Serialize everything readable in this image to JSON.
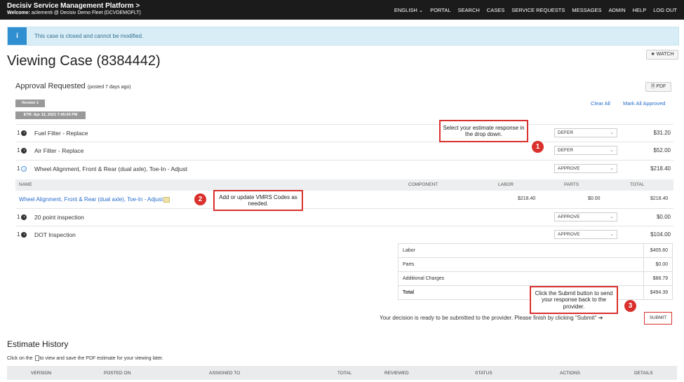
{
  "header": {
    "brand": "Decisiv Service Management Platform",
    "brand_chevron": ">",
    "welcome_prefix": "Welcome:",
    "welcome_text": "aclementi @ Decisiv Demo Fleet (DCVDEMOFLT)",
    "nav": [
      "ENGLISH ⌄",
      "PORTAL",
      "SEARCH",
      "CASES",
      "SERVICE REQUESTS",
      "MESSAGES",
      "ADMIN",
      "HELP",
      "LOG OUT"
    ]
  },
  "alert": {
    "icon": "i",
    "text": "This case is closed and cannot be modified."
  },
  "page": {
    "title": "Viewing Case (8384442)",
    "watch_label": "★ WATCH"
  },
  "approval": {
    "title": "Approval Requested",
    "posted": "(posted 7 days ago)",
    "pdf_label": "PDF",
    "version": "Version 1",
    "etr": "ETR: Apr 12, 2021 7:45:00 PM",
    "clear_all": "Clear All",
    "mark_all": "Mark All Approved"
  },
  "items": [
    {
      "qty": "1",
      "name": "Fuel Filter - Replace",
      "select": "DEFER",
      "price": "$31.20"
    },
    {
      "qty": "1",
      "name": "Air Filter - Replace",
      "select": "DEFER",
      "price": "$52.00"
    },
    {
      "qty": "1",
      "name": "Wheel Alignment, Front & Rear (dual axle), Toe-In - Adjust",
      "select": "APPROVE",
      "price": "$218.40"
    },
    {
      "qty": "1",
      "name": "20 point inspection",
      "select": "APPROVE",
      "price": "$0.00"
    },
    {
      "qty": "1",
      "name": "DOT Inspection",
      "select": "APPROVE",
      "price": "$104.00"
    }
  ],
  "detail_table": {
    "headers": [
      "NAME",
      "COMPONENT",
      "LABOR",
      "PARTS",
      "TOTAL"
    ],
    "row": {
      "name": "Wheel Alignment, Front & Rear (dual axle), Toe-In - Adjust",
      "component": "",
      "labor": "$218.40",
      "parts": "$0.00",
      "total": "$218.40"
    }
  },
  "totals": [
    {
      "label": "Labor",
      "value": "$405.60"
    },
    {
      "label": "Parts",
      "value": "$0.00"
    },
    {
      "label": "Additional Charges",
      "value": "$88.79"
    },
    {
      "label": "Total",
      "value": "$494.39"
    }
  ],
  "decision_text": "Your decision is ready to be submitted to the provider. Please finish by clicking \"Submit\" ➔",
  "submit_label": "SUBMIT",
  "callouts": {
    "c1": "Select your estimate response in the drop down.",
    "c2": "Add or update VMRS Codes as needed.",
    "c3": "Click the Submit button to send your response back to the provider.",
    "b1": "1",
    "b2": "2",
    "b3": "3"
  },
  "history": {
    "title": "Estimate History",
    "subtitle_pre": "Click on the",
    "subtitle_post": "to view and save the PDF estimate for your viewing later.",
    "headers": [
      "VERSION",
      "POSTED ON",
      "ASSIGNED TO",
      "TOTAL",
      "REVIEWED",
      "STATUS",
      "ACTIONS",
      "DETAILS"
    ]
  },
  "colors": {
    "accent_red": "#d9302c",
    "link_blue": "#2a6ecb",
    "info_blue": "#2f8fd0",
    "topbar": "#1b1b1b"
  }
}
